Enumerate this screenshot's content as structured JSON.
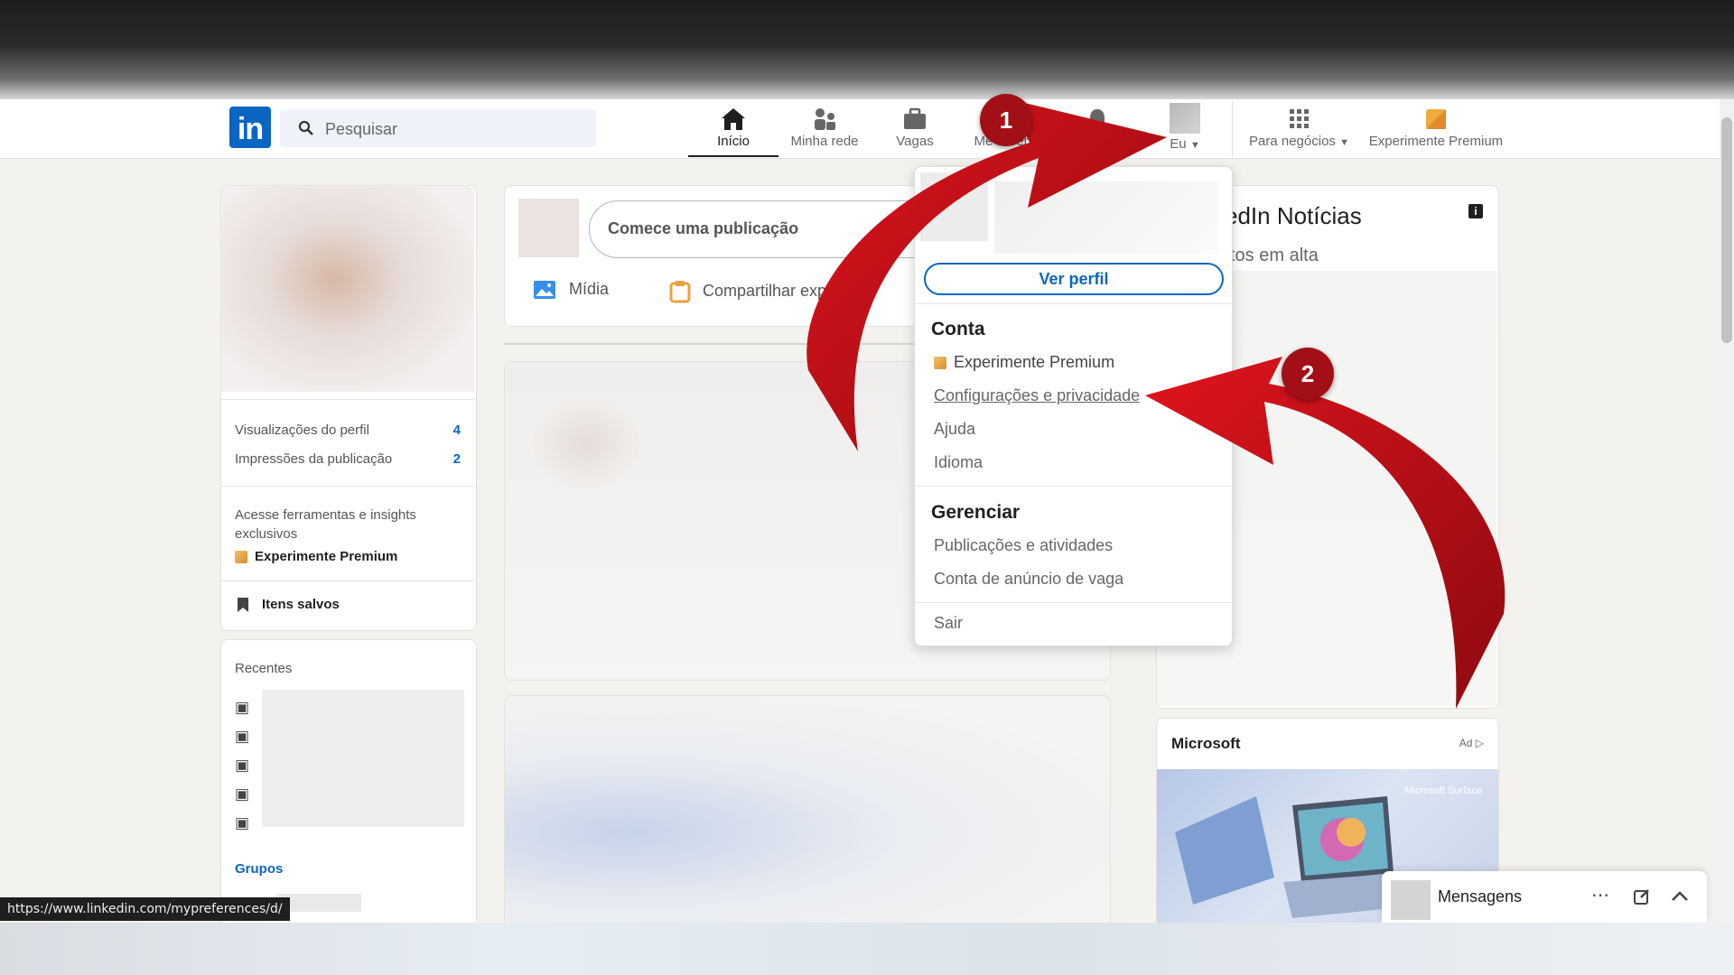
{
  "search": {
    "placeholder": "Pesquisar"
  },
  "nav": [
    {
      "label": "Início",
      "icon": "home-icon"
    },
    {
      "label": "Minha rede",
      "icon": "network-icon"
    },
    {
      "label": "Vagas",
      "icon": "briefcase-icon"
    },
    {
      "label": "Mensagens",
      "icon": "messaging-icon"
    },
    {
      "label": "Notificações",
      "icon": "bell-icon"
    },
    {
      "label": "Eu",
      "icon": "avatar"
    },
    {
      "label": "Para negócios",
      "icon": "grid-icon"
    },
    {
      "label": "Experimente Premium",
      "icon": "premium-icon"
    }
  ],
  "nav_visible": {
    "mensagens_partial": "Me",
    "mensagens_tail": "ens"
  },
  "left": {
    "stats": [
      {
        "label": "Visualizações do perfil",
        "value": "4"
      },
      {
        "label": "Impressões da publicação",
        "value": "2"
      }
    ],
    "premium_text": "Acesse ferramentas e insights exclusivos",
    "premium_link": "Experimente Premium",
    "saved": "Itens salvos",
    "recent_title": "Recentes",
    "groups_title": "Grupos"
  },
  "composer": {
    "placeholder": "Comece uma publicação",
    "media": "Mídia",
    "share": "Compartilhar exp"
  },
  "news": {
    "title": "edIn Notícias",
    "subtitle": "tos em alta"
  },
  "ad": {
    "company": "Microsoft",
    "ad_label": "Ad",
    "brand_text": "Microsoft Surface"
  },
  "dropdown": {
    "view_profile": "Ver perfil",
    "account_head": "Conta",
    "account_items": [
      "Experimente Premium",
      "Configurações e privacidade",
      "Ajuda",
      "Idioma"
    ],
    "manage_head": "Gerenciar",
    "manage_items": [
      "Publicações e atividades",
      "Conta de anúncio de vaga"
    ],
    "signout": "Sair"
  },
  "messaging": {
    "label": "Mensagens"
  },
  "status_url": "https://www.linkedin.com/mypreferences/d/",
  "annotations": [
    "1",
    "2"
  ],
  "colors": {
    "brand": "#0a66c2",
    "arrow": "#c4101a",
    "badge": "#a30f16"
  }
}
